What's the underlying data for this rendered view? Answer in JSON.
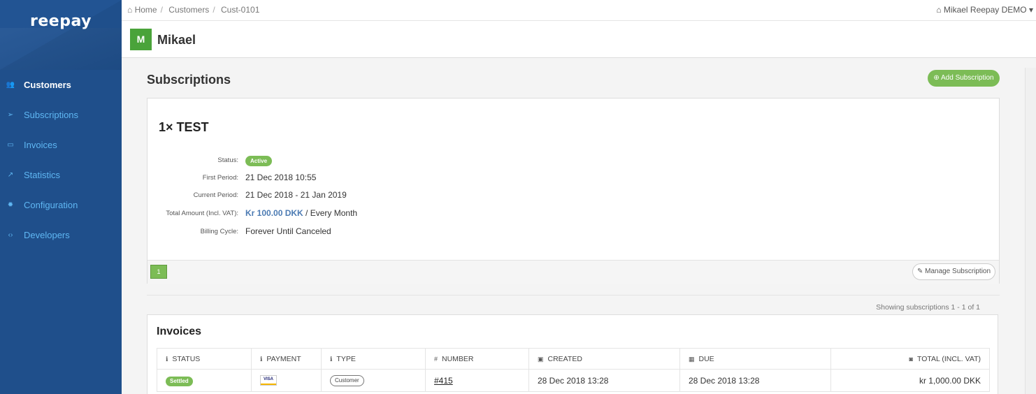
{
  "app": {
    "logo": "reepay"
  },
  "sidebar": {
    "items": [
      {
        "label": "Customers",
        "icon": "users-icon",
        "glyph": "👥"
      },
      {
        "label": "Subscriptions",
        "icon": "paper-plane-icon",
        "glyph": "➢"
      },
      {
        "label": "Invoices",
        "icon": "credit-card-icon",
        "glyph": "▭"
      },
      {
        "label": "Statistics",
        "icon": "trend-icon",
        "glyph": "↗"
      },
      {
        "label": "Configuration",
        "icon": "gear-icon",
        "glyph": "✹"
      },
      {
        "label": "Developers",
        "icon": "code-icon",
        "glyph": "‹›"
      }
    ],
    "active": "Customers"
  },
  "topbar": {
    "breadcrumb": [
      "Home",
      "Customers",
      "Cust-0101"
    ],
    "user": "Mikael Reepay DEMO"
  },
  "customer": {
    "initial": "M",
    "name": "Mikael"
  },
  "subscriptions": {
    "title": "Subscriptions",
    "add_button": "Add Subscription",
    "item": {
      "title": "1× TEST",
      "status_label": "Status:",
      "status_value": "Active",
      "first_period_label": "First Period:",
      "first_period_value": "21 Dec 2018 10:55",
      "current_period_label": "Current Period:",
      "current_period_value": "21 Dec 2018 - 21 Jan 2019",
      "total_amount_label": "Total Amount (Incl. VAT):",
      "total_amount_value": "Kr 100.00 DKK",
      "total_amount_suffix": " / Every Month",
      "billing_cycle_label": "Billing Cycle:",
      "billing_cycle_value": "Forever Until Canceled"
    },
    "page": "1",
    "manage_button": "Manage Subscription",
    "showing": "Showing subscriptions 1 - 1 of 1"
  },
  "invoices": {
    "title": "Invoices",
    "columns": [
      "STATUS",
      "PAYMENT",
      "TYPE",
      "NUMBER",
      "CREATED",
      "DUE",
      "TOTAL (INCL. VAT)"
    ],
    "rows": [
      {
        "status": "Settled",
        "payment": "VISA",
        "type": "Customer",
        "number": "#415",
        "created": "28 Dec 2018 13:28",
        "due": "28 Dec 2018 13:28",
        "total": "kr 1,000.00 DKK"
      }
    ]
  },
  "colors": {
    "sidebar": "#1f4f8b",
    "accent_green": "#7cbc56",
    "link_blue": "#5fb7f3"
  }
}
